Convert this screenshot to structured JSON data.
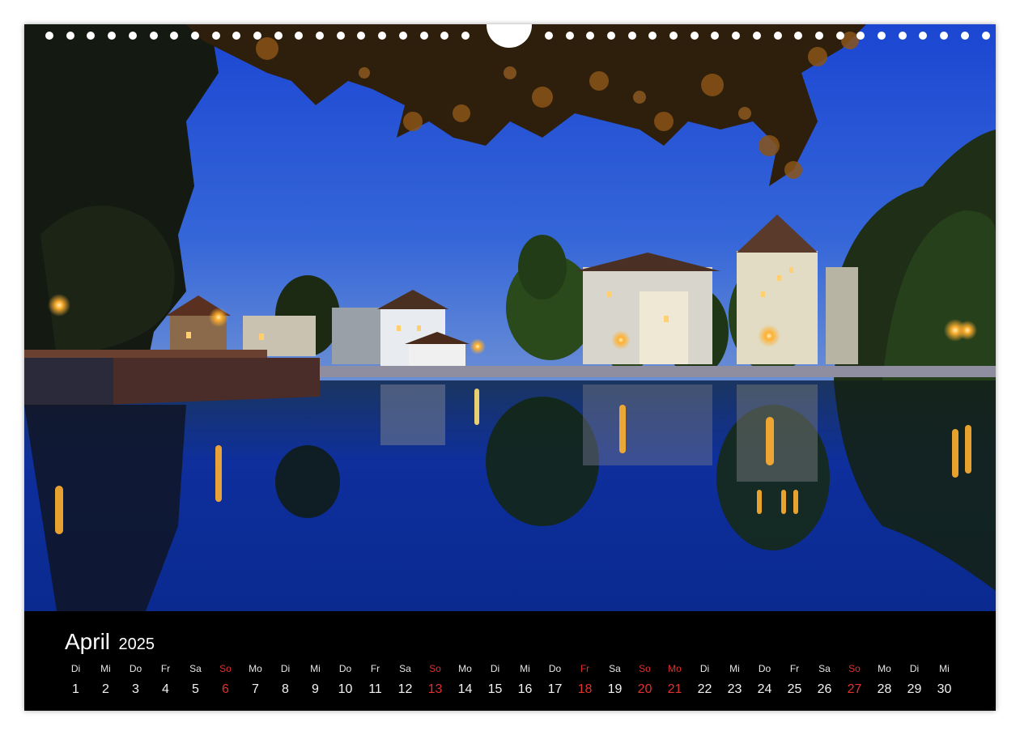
{
  "calendar": {
    "month": "April",
    "year": "2025",
    "days": [
      {
        "weekday": "Di",
        "day": "1",
        "red": false
      },
      {
        "weekday": "Mi",
        "day": "2",
        "red": false
      },
      {
        "weekday": "Do",
        "day": "3",
        "red": false
      },
      {
        "weekday": "Fr",
        "day": "4",
        "red": false
      },
      {
        "weekday": "Sa",
        "day": "5",
        "red": false
      },
      {
        "weekday": "So",
        "day": "6",
        "red": true
      },
      {
        "weekday": "Mo",
        "day": "7",
        "red": false
      },
      {
        "weekday": "Di",
        "day": "8",
        "red": false
      },
      {
        "weekday": "Mi",
        "day": "9",
        "red": false
      },
      {
        "weekday": "Do",
        "day": "10",
        "red": false
      },
      {
        "weekday": "Fr",
        "day": "11",
        "red": false
      },
      {
        "weekday": "Sa",
        "day": "12",
        "red": false
      },
      {
        "weekday": "So",
        "day": "13",
        "red": true
      },
      {
        "weekday": "Mo",
        "day": "14",
        "red": false
      },
      {
        "weekday": "Di",
        "day": "15",
        "red": false
      },
      {
        "weekday": "Mi",
        "day": "16",
        "red": false
      },
      {
        "weekday": "Do",
        "day": "17",
        "red": false
      },
      {
        "weekday": "Fr",
        "day": "18",
        "red": true
      },
      {
        "weekday": "Sa",
        "day": "19",
        "red": false
      },
      {
        "weekday": "So",
        "day": "20",
        "red": true
      },
      {
        "weekday": "Mo",
        "day": "21",
        "red": true
      },
      {
        "weekday": "Di",
        "day": "22",
        "red": false
      },
      {
        "weekday": "Mi",
        "day": "23",
        "red": false
      },
      {
        "weekday": "Do",
        "day": "24",
        "red": false
      },
      {
        "weekday": "Fr",
        "day": "25",
        "red": false
      },
      {
        "weekday": "Sa",
        "day": "26",
        "red": false
      },
      {
        "weekday": "So",
        "day": "27",
        "red": true
      },
      {
        "weekday": "Mo",
        "day": "28",
        "red": false
      },
      {
        "weekday": "Di",
        "day": "29",
        "red": false
      },
      {
        "weekday": "Mi",
        "day": "30",
        "red": false
      }
    ]
  },
  "colors": {
    "sky_top": "#1f4fd8",
    "sky_bottom": "#5a86d8",
    "water": "#0d2f9a",
    "foliage": "#2a1a0a",
    "lamp": "#ffb030",
    "holiday_red": "#e03030"
  }
}
